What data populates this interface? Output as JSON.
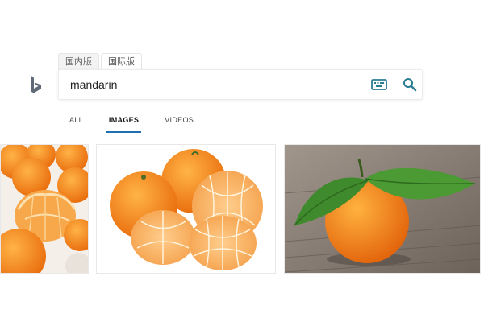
{
  "region_tabs": [
    {
      "label": "国内版",
      "active": false
    },
    {
      "label": "国际版",
      "active": true
    }
  ],
  "logo": {
    "icon": "bing-logo-icon",
    "color": "#5e6a77"
  },
  "search": {
    "value": "mandarin",
    "keyboard_icon": "keyboard-icon",
    "search_icon": "search-icon",
    "icon_color": "#2a7c92"
  },
  "nav": {
    "items": [
      {
        "label": "ALL",
        "active": false
      },
      {
        "label": "IMAGES",
        "active": true
      },
      {
        "label": "VIDEOS",
        "active": false
      }
    ],
    "accent": "#1f6fb2"
  },
  "results": [
    {
      "subject": "peeled mandarins on white surface"
    },
    {
      "subject": "mandarins and peeled segments on white background"
    },
    {
      "subject": "mandarin with green leaves on wooden table"
    }
  ]
}
